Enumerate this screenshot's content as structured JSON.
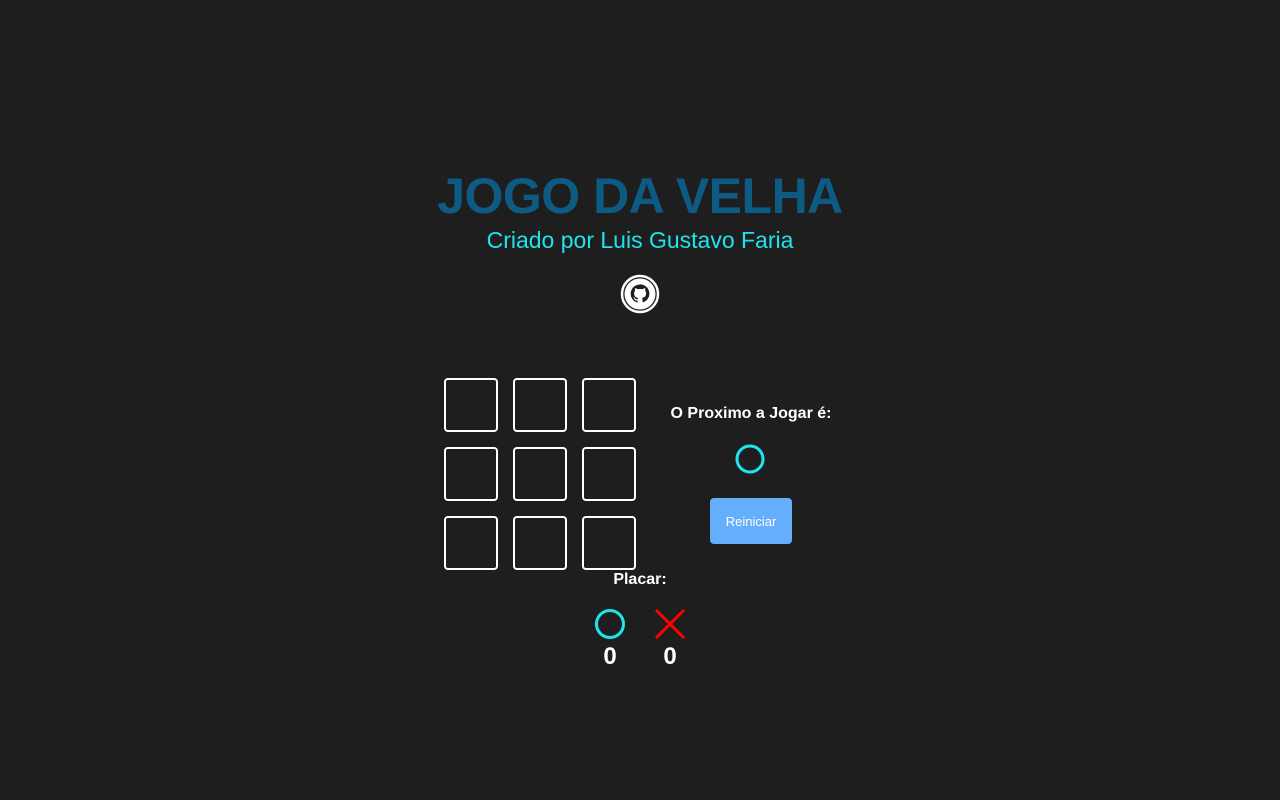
{
  "header": {
    "title": "JOGO DA VELHA",
    "subtitle": "Criado por Luis Gustavo Faria",
    "link_icon": "github-icon"
  },
  "board": {
    "cells": [
      "",
      "",
      "",
      "",
      "",
      "",
      "",
      "",
      ""
    ]
  },
  "turn": {
    "label": "O Proximo a Jogar é:",
    "next_player": "O",
    "next_player_icon": "circle-icon"
  },
  "controls": {
    "reset_label": "Reiniciar"
  },
  "scoreboard": {
    "label": "Placar:",
    "o_score": "0",
    "x_score": "0",
    "o_icon": "circle-icon",
    "x_icon": "cross-icon"
  },
  "colors": {
    "background": "#1e1e1e",
    "title": "#0d5a82",
    "subtitle": "#1de4ef",
    "player_o": "#1de4ef",
    "player_x": "#ff0000",
    "button": "#64aefc",
    "cell_border": "#ffffff"
  }
}
